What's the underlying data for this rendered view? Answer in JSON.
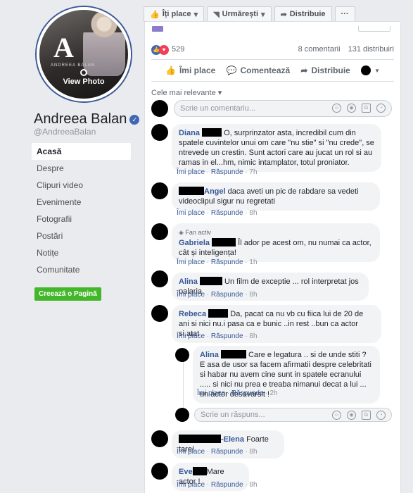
{
  "topbar": {
    "like_label": "Îți place",
    "follow_label": "Urmărești",
    "share_label": "Distribuie",
    "more_label": "···"
  },
  "profile": {
    "view_photo": "View Photo",
    "pic_letter": "A",
    "pic_sub": "ANDREEA BALAN",
    "name": "Andreea Balan",
    "handle": "@AndreeaBalan",
    "verified_glyph": "✓"
  },
  "nav": {
    "items": [
      "Acasă",
      "Despre",
      "Clipuri video",
      "Evenimente",
      "Fotografii",
      "Postări",
      "Notițe",
      "Comunitate"
    ],
    "active": "Acasă",
    "create_page": "Creează o Pagină"
  },
  "post": {
    "reaction_count": "529",
    "comments_count": "8 comentarii",
    "shares_count": "131 distribuiri",
    "like_action": "Îmi place",
    "comment_action": "Comentează",
    "share_action": "Distribuie",
    "sort_label": "Cele mai relevante"
  },
  "composer": {
    "placeholder": "Scrie un comentariu...",
    "reply_placeholder": "Scrie un răspuns..."
  },
  "comment_actions": {
    "like": "Îmi place",
    "reply": "Răspunde",
    "separator": "·"
  },
  "comments": [
    {
      "author": "Diana",
      "text": "O, surprinzator asta, incredibil cum din spatele cuvintelor unui om care \"nu stie\" si \"nu crede\", se ntrevede un crestin. Sunt actori care au jucat un rol si au ramas in el...hm, nimic intamplator, totul proniator.",
      "time": "7h"
    },
    {
      "author": "Angel",
      "text": "daca aveti un pic de rabdare sa vedeti videoclipul sigur nu regretati",
      "time": "8h"
    },
    {
      "badge": "Fan activ",
      "author": "Gabriela",
      "text": "Îl ador pe acest om, nu numai ca actor, cât și inteligența!",
      "time": "1h"
    },
    {
      "author": "Alina",
      "text": "Un film de exceptie ... rol interpretat jos palaria",
      "time": "8h"
    },
    {
      "author": "Rebeca",
      "text": "Da, pacat ca nu vb cu fiica lui de 20 de ani si nici nu.i pasa ca e bunic ..in rest ..bun ca actor si.atat",
      "time": "8h"
    },
    {
      "author": "Alina",
      "text": "Care e legatura .. si de unde stiti ? E asa de usor sa facem afirmatii despre celebritati si habar nu avem cine sunt in spatele ecranului ..... si nici nu prea e treaba nimanui decat a lui ... un actor desavarsit !",
      "time": "2h"
    },
    {
      "author": "-Elena",
      "text": "Foarte tare!",
      "time": "8h"
    },
    {
      "author": "Eve",
      "text": "Mare actor !",
      "time": "8h"
    }
  ]
}
